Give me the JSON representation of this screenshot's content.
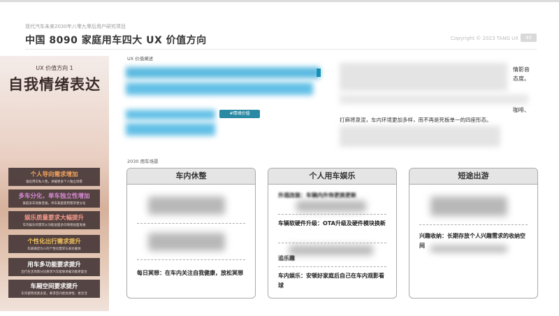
{
  "header": {
    "subtitle": "现代汽车未来2030年八零九零后用户研究项目",
    "title": "中国 8090 家庭用车四大 UX 价值方向",
    "copyright": "Copyright © 2023 TANG UX",
    "page_number": "40"
  },
  "left_panel": {
    "tag": "UX 价值方向 1",
    "title": "自我情绪表达",
    "items": [
      {
        "head": "个人导向需求增加",
        "sub": "强化用车私人性，承载更多个人独立场景"
      },
      {
        "head": "多车分化，单车独立性增加",
        "sub": "家庭多车现象普遍，单车家庭使用需求更分化"
      },
      {
        "head": "娱乐质量要求大幅提升",
        "sub": "车内娱乐的需求从功能层面多向情感层面发展"
      },
      {
        "head": "个性化出行需求提升",
        "sub": "车辆满足为人的个性化需求与表达载体"
      },
      {
        "head": "用车多功能要求提升",
        "sub": "出行生活场景分化要求汽车能够承载功能更复合"
      },
      {
        "head": "车厢空间要求提升",
        "sub": "车内使用场景多变，要求空间更具弹性、更灵活"
      }
    ]
  },
  "main": {
    "ux_label": "UX 价值阐述",
    "tag": "#情绪价值",
    "handwritten": {
      "line1": "情影音",
      "line2": "态度。",
      "line3": "咖啡、",
      "line4": "打麻将泉泥，车内环境更加多样，而不再是死板单一的四座形态。"
    },
    "scene_label": "2030 用车场景"
  },
  "cards": [
    {
      "title": "车内休整",
      "items": [
        "每日冥想：在车内关注自我健康，放松冥想"
      ]
    },
    {
      "title": "个人用车娱乐",
      "items": [
        "外观改装：车辆内外饰更换更新",
        "车辆软硬件升级：OTA升级及硬件模块换新",
        "追乐趣",
        "车内娱乐：安顿好家庭后自己在车内观影看球"
      ]
    },
    {
      "title": "短途出游",
      "items": [
        "兴趣收纳：长期存放个人兴趣需求的收纳空间"
      ]
    }
  ],
  "colors": {
    "accent_teal": "#2a8aa4",
    "panel_dark": "#463737"
  }
}
